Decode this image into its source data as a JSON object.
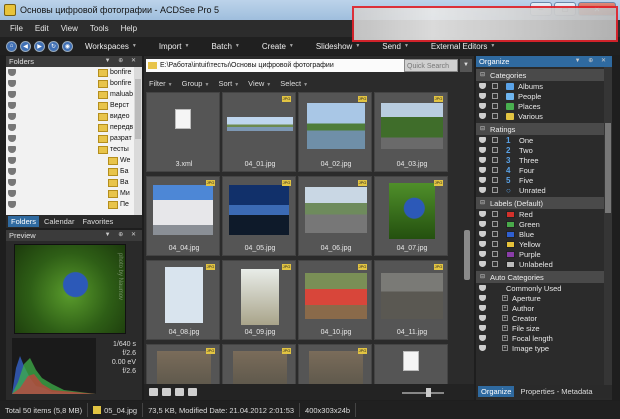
{
  "window": {
    "title": "Основы цифровой фотографии - ACDSee Pro 5",
    "controls": [
      "–",
      "▭",
      "✕"
    ]
  },
  "menu": [
    "File",
    "Edit",
    "View",
    "Tools",
    "Help"
  ],
  "toolbar": {
    "modes": [
      "Workspaces",
      "Import",
      "Batch",
      "Create",
      "Slideshow",
      "Send",
      "External Editors"
    ]
  },
  "folders_panel": {
    "title": "Folders",
    "items": [
      "bonfire",
      "bonfire",
      "maluab",
      "Верст",
      "видео",
      "передв",
      "разрат",
      "тесты",
      "We",
      "Ба",
      "Ва",
      "Ми",
      "Пе"
    ],
    "tabs": [
      "Folders",
      "Calendar",
      "Favorites"
    ]
  },
  "preview_panel": {
    "title": "Preview",
    "watermark": "photo by Naumov",
    "exif": [
      "1/640 s",
      "f/2.6",
      "0.00 eV",
      "f/2.6"
    ]
  },
  "browser": {
    "path": "E:\\Работа\\intuit\\тесты\\Основы цифровой фотографии",
    "quick_search_placeholder": "Quick Search",
    "filters": [
      "Filter",
      "Group",
      "Sort",
      "View",
      "Select"
    ],
    "badge": "JPG",
    "files": [
      {
        "name": "3.xml",
        "kind": "doc"
      },
      {
        "name": "04_01.jpg",
        "kind": "landscape-sky"
      },
      {
        "name": "04_02.jpg",
        "kind": "lake"
      },
      {
        "name": "04_03.jpg",
        "kind": "road-trees"
      },
      {
        "name": "04_04.jpg",
        "kind": "cathedral"
      },
      {
        "name": "04_05.jpg",
        "kind": "sunset"
      },
      {
        "name": "04_06.jpg",
        "kind": "street"
      },
      {
        "name": "04_07.jpg",
        "kind": "flower"
      },
      {
        "name": "04_08.jpg",
        "kind": "statue"
      },
      {
        "name": "04_09.jpg",
        "kind": "bells"
      },
      {
        "name": "04_10.jpg",
        "kind": "flowers-people"
      },
      {
        "name": "04_11.jpg",
        "kind": "pigeons"
      },
      {
        "name": "",
        "kind": "partial"
      },
      {
        "name": "",
        "kind": "partial"
      },
      {
        "name": "",
        "kind": "partial"
      },
      {
        "name": "",
        "kind": "doc-partial"
      }
    ]
  },
  "organize_panel": {
    "title": "Organize",
    "categories": {
      "title": "Categories",
      "items": [
        {
          "label": "Albums",
          "color": "#5aa3e8"
        },
        {
          "label": "People",
          "color": "#6fb6f0"
        },
        {
          "label": "Places",
          "color": "#49b04f"
        },
        {
          "label": "Various",
          "color": "#e2c442"
        }
      ]
    },
    "ratings": {
      "title": "Ratings",
      "items": [
        {
          "num": "1",
          "label": "One"
        },
        {
          "num": "2",
          "label": "Two"
        },
        {
          "num": "3",
          "label": "Three"
        },
        {
          "num": "4",
          "label": "Four"
        },
        {
          "num": "5",
          "label": "Five"
        },
        {
          "num": "○",
          "label": "Unrated"
        }
      ]
    },
    "labels": {
      "title": "Labels (Default)",
      "items": [
        {
          "label": "Red",
          "color": "#d3312b"
        },
        {
          "label": "Green",
          "color": "#49a94a"
        },
        {
          "label": "Blue",
          "color": "#2f5fcf"
        },
        {
          "label": "Yellow",
          "color": "#e6c23a"
        },
        {
          "label": "Purple",
          "color": "#8a3da8"
        },
        {
          "label": "Unlabeled",
          "color": "#bcbcbc"
        }
      ]
    },
    "auto_categories": {
      "title": "Auto Categories",
      "root": "Commonly Used",
      "items": [
        "Aperture",
        "Author",
        "Creator",
        "File size",
        "Focal length",
        "Image type"
      ]
    },
    "tabs": [
      "Organize",
      "Properties - Metadata"
    ]
  },
  "statusbar": {
    "total": "Total 50 items",
    "size": "(5,8 MB)",
    "file": "05_04.jpg",
    "info": "73,5 KB, Modified Date: 21.04.2012 2:01:53",
    "dims": "400x303x24b"
  }
}
